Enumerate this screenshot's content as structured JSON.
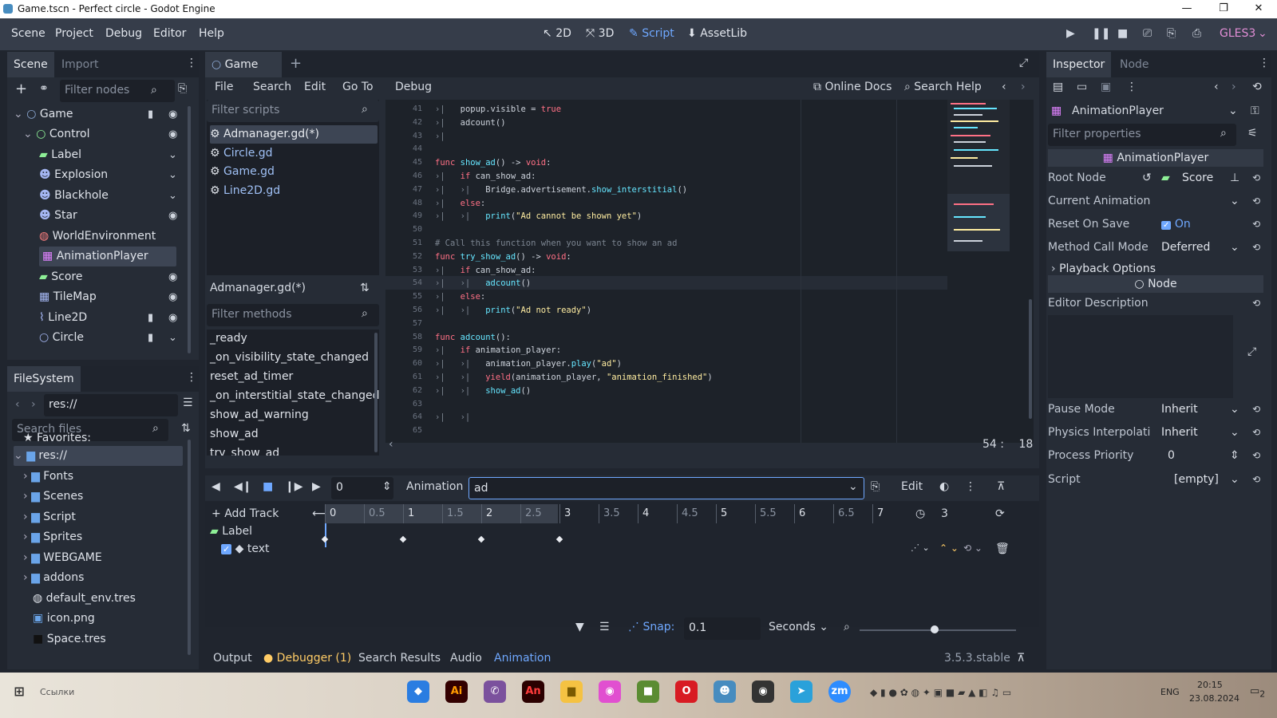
{
  "window": {
    "title": "Game.tscn - Perfect circle - Godot Engine",
    "minimize": "—",
    "maximize": "❐",
    "close": "✕"
  },
  "menu": [
    "Scene",
    "Project",
    "Debug",
    "Editor",
    "Help"
  ],
  "modes": {
    "m2d": "2D",
    "m3d": "3D",
    "script": "Script",
    "assetlib": "AssetLib"
  },
  "renderer": "GLES3",
  "scene_dock": {
    "tab_scene": "Scene",
    "tab_import": "Import",
    "filter_placeholder": "Filter nodes",
    "nodes": [
      {
        "label": "Game",
        "icon": "○",
        "color": "#8eabd6"
      },
      {
        "label": "Control",
        "icon": "○",
        "color": "#8eef97"
      },
      {
        "label": "Label",
        "icon": "▰",
        "color": "#8eef97"
      },
      {
        "label": "Explosion",
        "icon": "☻",
        "color": "#a5b7f3"
      },
      {
        "label": "Blackhole",
        "icon": "☻",
        "color": "#a5b7f3"
      },
      {
        "label": "Star",
        "icon": "☻",
        "color": "#a5b7f3"
      },
      {
        "label": "WorldEnvironment",
        "icon": "◍",
        "color": "#fc7f7f"
      },
      {
        "label": "AnimationPlayer",
        "icon": "▦",
        "color": "#e082ff"
      },
      {
        "label": "Score",
        "icon": "▰",
        "color": "#8eef97"
      },
      {
        "label": "TileMap",
        "icon": "▦",
        "color": "#a5b7f3"
      },
      {
        "label": "Line2D",
        "icon": "⌇",
        "color": "#a5b7f3"
      },
      {
        "label": "Circle",
        "icon": "○",
        "color": "#a5b7f3"
      }
    ]
  },
  "filesystem": {
    "tab": "FileSystem",
    "path": "res://",
    "search_placeholder": "Search files",
    "favorites": "Favorites:",
    "root": "res://",
    "items": [
      "Fonts",
      "Scenes",
      "Script",
      "Sprites",
      "WEBGAME",
      "addons",
      "default_env.tres",
      "icon.png",
      "Space.tres"
    ]
  },
  "editor_tab": "Game",
  "script_menu": [
    "File",
    "Search",
    "Edit",
    "Go To",
    "Debug"
  ],
  "script_help": {
    "online_docs": "Online Docs",
    "search_help": "Search Help"
  },
  "scripts": {
    "filter_placeholder": "Filter scripts",
    "items": [
      "Admanager.gd(*)",
      "Circle.gd",
      "Game.gd",
      "Line2D.gd"
    ],
    "current": "Admanager.gd(*)",
    "methods_placeholder": "Filter methods",
    "methods": [
      "_ready",
      "_on_visibility_state_changed",
      "reset_ad_timer",
      "_on_interstitial_state_changed",
      "show_ad_warning",
      "show_ad",
      "try_show_ad"
    ]
  },
  "code_lines": [
    {
      "n": "41",
      "html": "<span class='cm'>›|</span>   popup.visible = <span class='kw'>true</span>"
    },
    {
      "n": "42",
      "html": "<span class='cm'>›|</span>   adcount()"
    },
    {
      "n": "43",
      "html": "<span class='cm'>›|</span>"
    },
    {
      "n": "44",
      "html": ""
    },
    {
      "n": "45",
      "html": "<span class='kw'>func</span> <span class='fn'>show_ad</span>() -> <span class='kw'>void</span>:"
    },
    {
      "n": "46",
      "html": "<span class='cm'>›|</span>   <span class='kw'>if</span> can_show_ad:"
    },
    {
      "n": "47",
      "html": "<span class='cm'>›|   ›|</span>   Bridge.advertisement.<span class='fn'>show_interstitial</span>()"
    },
    {
      "n": "48",
      "html": "<span class='cm'>›|</span>   <span class='kw'>else</span>:"
    },
    {
      "n": "49",
      "html": "<span class='cm'>›|   ›|</span>   <span class='fn'>print</span>(<span class='st'>\"Ad cannot be shown yet\"</span>)"
    },
    {
      "n": "50",
      "html": ""
    },
    {
      "n": "51",
      "html": "<span class='cm'># Call this function when you want to show an ad</span>"
    },
    {
      "n": "52",
      "html": "<span class='kw'>func</span> <span class='fn'>try_show_ad</span>() -> <span class='kw'>void</span>:"
    },
    {
      "n": "53",
      "html": "<span class='cm'>›|</span>   <span class='kw'>if</span> can_show_ad:"
    },
    {
      "n": "54",
      "html": "<span class='cm'>›|   ›|</span>   <span class='fn'>adcount</span>()"
    },
    {
      "n": "55",
      "html": "<span class='cm'>›|</span>   <span class='kw'>else</span>:"
    },
    {
      "n": "56",
      "html": "<span class='cm'>›|   ›|</span>   <span class='fn'>print</span>(<span class='st'>\"Ad not ready\"</span>)"
    },
    {
      "n": "57",
      "html": ""
    },
    {
      "n": "58",
      "html": "<span class='kw'>func</span> <span class='fn'>adcount</span>():"
    },
    {
      "n": "59",
      "html": "<span class='cm'>›|</span>   <span class='kw'>if</span> animation_player:"
    },
    {
      "n": "60",
      "html": "<span class='cm'>›|   ›|</span>   animation_player.<span class='fn'>play</span>(<span class='st'>\"ad\"</span>)"
    },
    {
      "n": "61",
      "html": "<span class='cm'>›|   ›|</span>   <span class='kw'>yield</span>(animation_player, <span class='st'>\"animation_finished\"</span>)"
    },
    {
      "n": "62",
      "html": "<span class='cm'>›|   ›|</span>   <span class='fn'>show_ad</span>()"
    },
    {
      "n": "63",
      "html": ""
    },
    {
      "n": "64",
      "html": "<span class='cm'>›|   ›|</span>"
    },
    {
      "n": "65",
      "html": ""
    }
  ],
  "cursor": {
    "line": "54",
    "sep": ":",
    "col": "18"
  },
  "animation": {
    "time": "0",
    "label": "Animation",
    "name": "ad",
    "edit": "Edit",
    "add_track": "Add Track",
    "ticks": [
      "0",
      "0.5",
      "1",
      "1.5",
      "2",
      "2.5",
      "3",
      "3.5",
      "4",
      "4.5",
      "5",
      "5.5",
      "6",
      "6.5",
      "7"
    ],
    "length": "3",
    "track_node": "Label",
    "track_prop": "text",
    "snap_label": "Snap:",
    "snap_value": "0.1",
    "snap_unit": "Seconds"
  },
  "bottom_tabs": {
    "output": "Output",
    "debugger": "Debugger (1)",
    "search": "Search Results",
    "audio": "Audio",
    "animation": "Animation",
    "version": "3.5.3.stable"
  },
  "inspector": {
    "tab_inspector": "Inspector",
    "tab_node": "Node",
    "object": "AnimationPlayer",
    "filter_placeholder": "Filter properties",
    "class_header": "AnimationPlayer",
    "root_node_label": "Root Node",
    "root_node_value": "Score",
    "current_animation": "Current Animation",
    "reset_on_save": "Reset On Save",
    "reset_on_save_value": "On",
    "method_call_mode": "Method Call Mode",
    "method_call_mode_value": "Deferred",
    "playback_options": "Playback Options",
    "node_header": "Node",
    "editor_description": "Editor Description",
    "pause_mode": "Pause Mode",
    "pause_mode_value": "Inherit",
    "physics_interp": "Physics Interpolati",
    "physics_interp_value": "Inherit",
    "process_priority": "Process Priority",
    "process_priority_value": "0",
    "script": "Script",
    "script_value": "[empty]"
  },
  "taskbar": {
    "search_text": "Ссылки",
    "lang": "ENG",
    "time": "20:15",
    "date": "23.08.2024",
    "notif": "2"
  }
}
